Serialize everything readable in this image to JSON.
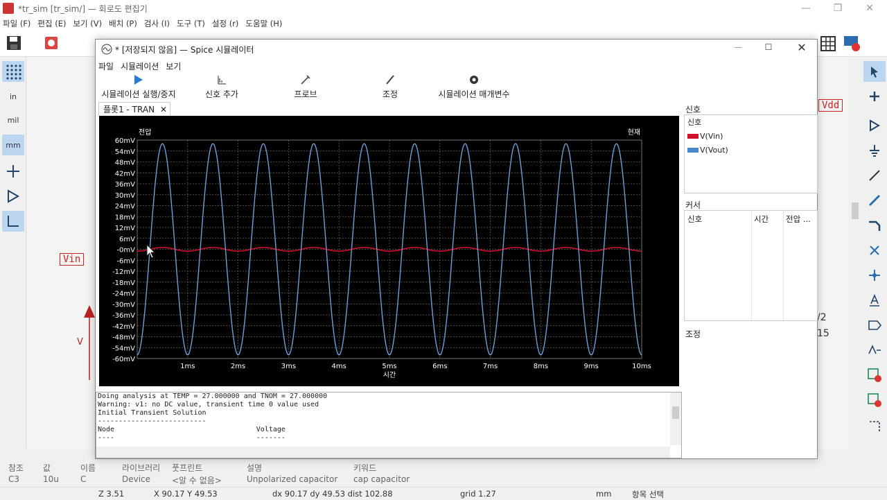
{
  "app": {
    "title": "*tr_sim [tr_sim/] — 회로도 편집기",
    "menu": [
      "파일 (F)",
      "편집 (E)",
      "보기 (V)",
      "배치 (P)",
      "검사 (I)",
      "도구 (T)",
      "설정 (r)",
      "도움말 (H)"
    ]
  },
  "left_tools": [
    "in",
    "mil",
    "mm"
  ],
  "schematic": {
    "vin_label": "Vin",
    "vdd_label": "Vdd",
    "v_label": "V",
    "frag1": "/2",
    "frag2": "15"
  },
  "props": {
    "headers": [
      "참조",
      "값",
      "이름",
      "라이브러리",
      "풋프린트",
      "설명",
      "키워드"
    ],
    "values": [
      "C3",
      "10u",
      "C",
      "Device",
      "<알 수 없음>",
      "Unpolarized capacitor",
      "cap capacitor"
    ]
  },
  "status": {
    "z": "Z 3.51",
    "xy": "X 90.17  Y 49.53",
    "dxy": "dx 90.17  dy 49.53  dist 102.88",
    "grid": "grid 1.27",
    "unit": "mm",
    "mode": "항목 선택"
  },
  "sim": {
    "title": "* [저장되지 않음] — Spice 시뮬레이터",
    "menu": [
      "파일",
      "시뮬레이션",
      "보기"
    ],
    "toolbar": [
      "시뮬레이션 실행/중지",
      "신호 추가",
      "프로브",
      "조정",
      "시뮬레이션 매개변수"
    ],
    "tab": "플롯1 - TRAN",
    "signals_caption": "신호",
    "signals_header": "신호",
    "signals": [
      {
        "name": "V(Vin)",
        "color": "#d0102a"
      },
      {
        "name": "V(Vout)",
        "color": "#4a86c8"
      }
    ],
    "cursor_caption": "커서",
    "cursor_cols": [
      "신호",
      "시간",
      "전압 ..."
    ],
    "tune_caption": "조정",
    "log": [
      "Doing analysis at TEMP = 27.000000 and TNOM = 27.000000",
      "Warning: v1: no DC value, transient time 0 value used",
      "Initial Transient Solution",
      "--------------------------",
      "",
      "Node                                  Voltage",
      "----                                  -------"
    ]
  },
  "chart_data": {
    "type": "line",
    "xlabel": "시간",
    "left_label": "전압",
    "right_label": "현재",
    "xlim": [
      0,
      10
    ],
    "ylim": [
      -60,
      60
    ],
    "x_ticks": [
      "1ms",
      "2ms",
      "3ms",
      "4ms",
      "5ms",
      "6ms",
      "7ms",
      "8ms",
      "9ms",
      "10ms"
    ],
    "y_ticks": [
      "60mV",
      "54mV",
      "48mV",
      "42mV",
      "36mV",
      "30mV",
      "24mV",
      "18mV",
      "12mV",
      "6mV",
      "-0mV",
      "-6mV",
      "-12mV",
      "-18mV",
      "-24mV",
      "-30mV",
      "-36mV",
      "-42mV",
      "-48mV",
      "-54mV",
      "-60mV"
    ],
    "grid": true,
    "series": [
      {
        "name": "V(Vin)",
        "color": "#d0102a",
        "amplitude_mV": 1,
        "frequency_kHz": 1
      },
      {
        "name": "V(Vout)",
        "color": "#6f9fd6",
        "amplitude_mV": 58,
        "frequency_kHz": 1
      }
    ]
  }
}
